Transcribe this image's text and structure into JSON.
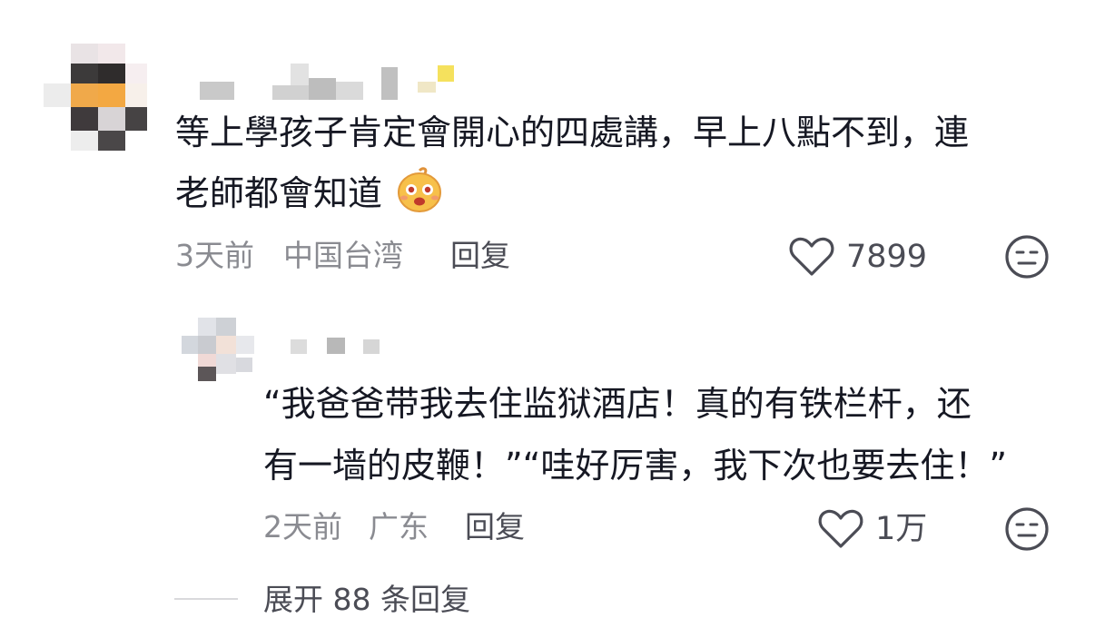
{
  "comments": [
    {
      "text_line1": "等上學孩子肯定會開心的四處講，早上八點不到，連",
      "text_line2": "老師都會知道",
      "time": "3天前",
      "location": "中国台湾",
      "reply_label": "回复",
      "likes": "7899"
    }
  ],
  "replies": [
    {
      "text_line1": "“我爸爸带我去住监狱酒店！真的有铁栏杆，还",
      "text_line2": "有一墙的皮鞭！”“哇好厉害，我下次也要去住！”",
      "time": "2天前",
      "location": "广东",
      "reply_label": "回复",
      "likes": "1万"
    }
  ],
  "expand_label": "展开 88 条回复",
  "icons": {
    "like": "heart-outline-icon",
    "dislike": "neutral-face-icon",
    "emoji": "grinning-face-emoji"
  },
  "colors": {
    "text": "#161823",
    "meta": "#8a8b91",
    "action": "#4b4c55"
  }
}
